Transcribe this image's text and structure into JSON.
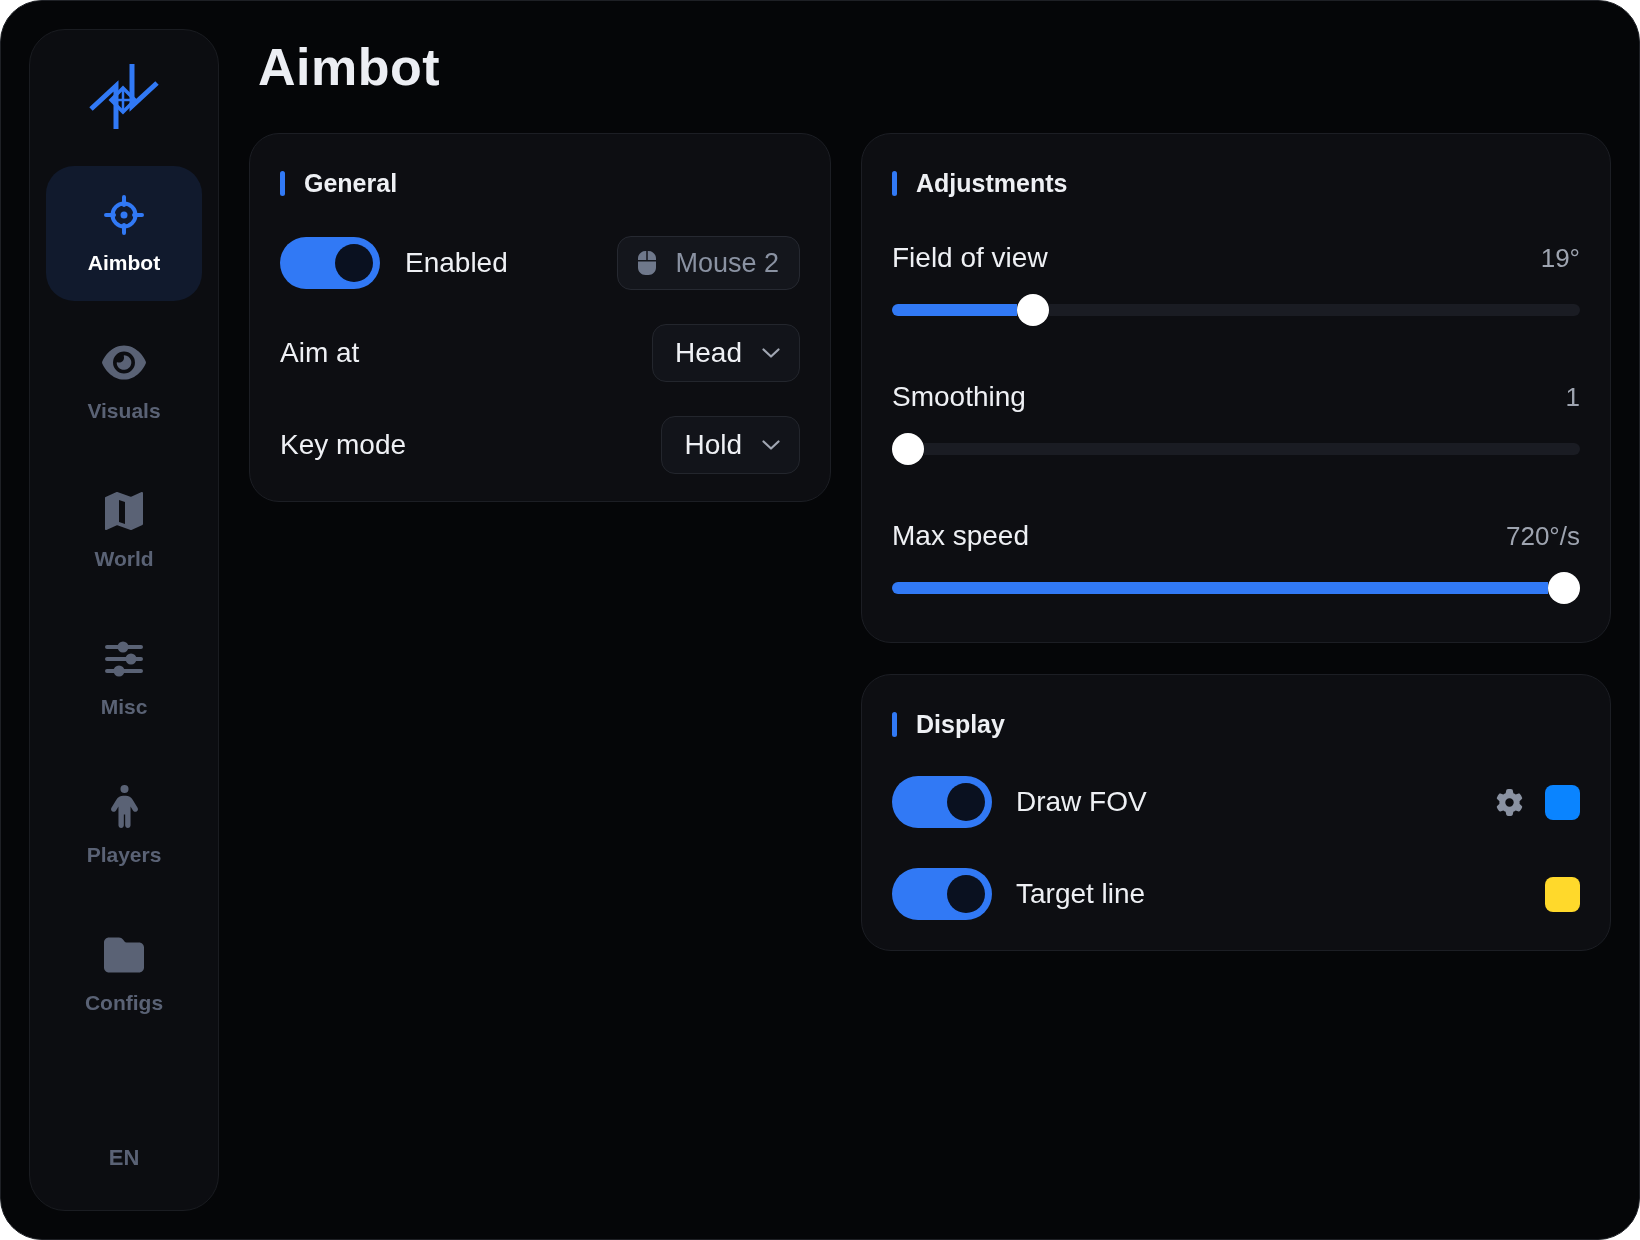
{
  "sidebar": {
    "items": [
      {
        "label": "Aimbot",
        "selected": true
      },
      {
        "label": "Visuals",
        "selected": false
      },
      {
        "label": "World",
        "selected": false
      },
      {
        "label": "Misc",
        "selected": false
      },
      {
        "label": "Players",
        "selected": false
      },
      {
        "label": "Configs",
        "selected": false
      }
    ],
    "language": "EN"
  },
  "page_title": "Aimbot",
  "general": {
    "title": "General",
    "enabled": {
      "label": "Enabled",
      "on": true
    },
    "keybind": "Mouse 2",
    "selects": [
      {
        "label": "Aim at",
        "value": "Head"
      },
      {
        "label": "Key mode",
        "value": "Hold"
      }
    ]
  },
  "adjustments": {
    "title": "Adjustments",
    "sliders": [
      {
        "label": "Field of view",
        "reading": "19°",
        "level": 0.19
      },
      {
        "label": "Smoothing",
        "reading": "1",
        "level": 0
      },
      {
        "label": "Max speed",
        "reading": "720°/s",
        "level": 1
      }
    ]
  },
  "display": {
    "title": "Display",
    "options": [
      {
        "label": "Draw FOV",
        "on": true,
        "settings_button": true,
        "color": "#0a84ff"
      },
      {
        "label": "Target line",
        "on": true,
        "settings_button": false,
        "color": "#ffd92b"
      }
    ]
  }
}
